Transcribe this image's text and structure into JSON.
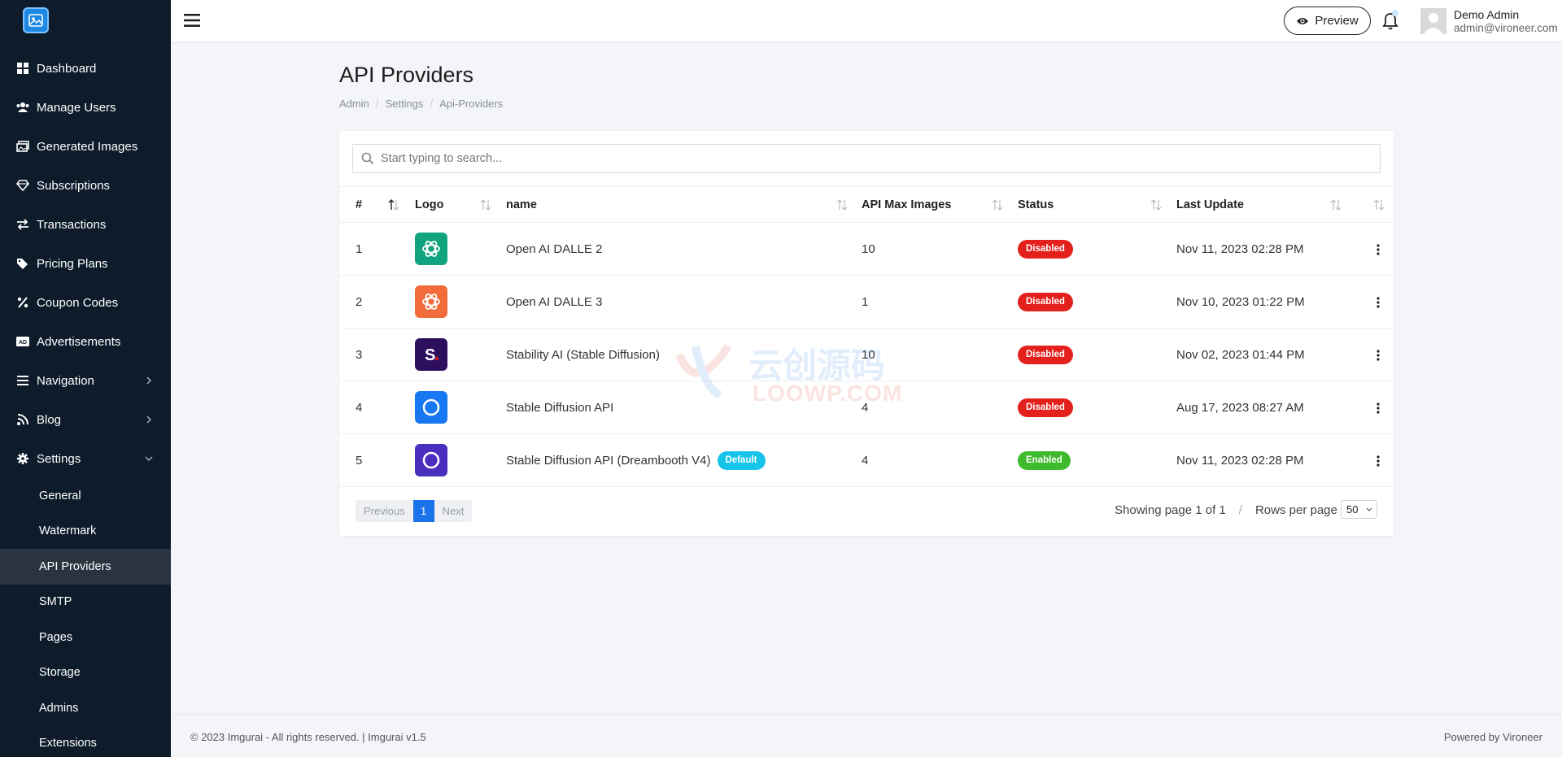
{
  "sidebar": {
    "items": [
      {
        "label": "Dashboard",
        "icon": "grid-icon"
      },
      {
        "label": "Manage Users",
        "icon": "users-icon"
      },
      {
        "label": "Generated Images",
        "icon": "images-icon"
      },
      {
        "label": "Subscriptions",
        "icon": "diamond-icon"
      },
      {
        "label": "Transactions",
        "icon": "exchange-icon"
      },
      {
        "label": "Pricing Plans",
        "icon": "tags-icon"
      },
      {
        "label": "Coupon Codes",
        "icon": "percent-icon"
      },
      {
        "label": "Advertisements",
        "icon": "ad-icon"
      },
      {
        "label": "Navigation",
        "icon": "bars-icon"
      },
      {
        "label": "Blog",
        "icon": "rss-icon"
      },
      {
        "label": "Settings",
        "icon": "gear-icon"
      }
    ],
    "settings_sub": [
      {
        "label": "General"
      },
      {
        "label": "Watermark"
      },
      {
        "label": "API Providers"
      },
      {
        "label": "SMTP"
      },
      {
        "label": "Pages"
      },
      {
        "label": "Storage"
      },
      {
        "label": "Admins"
      },
      {
        "label": "Extensions"
      }
    ]
  },
  "topbar": {
    "preview_label": "Preview",
    "user_name": "Demo Admin",
    "user_email": "admin@vironeer.com"
  },
  "page": {
    "title": "API Providers",
    "breadcrumb": [
      "Admin",
      "Settings",
      "Api-Providers"
    ]
  },
  "search": {
    "placeholder": "Start typing to search..."
  },
  "table": {
    "headers": [
      "#",
      "Logo",
      "name",
      "API Max Images",
      "Status",
      "Last Update"
    ],
    "rows": [
      {
        "num": "1",
        "name": "Open AI DALLE 2",
        "max": "10",
        "status": "Disabled",
        "updated": "Nov 11, 2023 02:28 PM",
        "logo_color": "#10a37f",
        "logo": "openai-logo-icon"
      },
      {
        "num": "2",
        "name": "Open AI DALLE 3",
        "max": "1",
        "status": "Disabled",
        "updated": "Nov 10, 2023 01:22 PM",
        "logo_color": "#f26b3a",
        "logo": "openai-logo-icon"
      },
      {
        "num": "3",
        "name": "Stability AI (Stable Diffusion)",
        "max": "10",
        "status": "Disabled",
        "updated": "Nov 02, 2023 01:44 PM",
        "logo_color": "#2d0f5e",
        "logo": "stability-logo-icon"
      },
      {
        "num": "4",
        "name": "Stable Diffusion API",
        "max": "4",
        "status": "Disabled",
        "updated": "Aug 17, 2023 08:27 AM",
        "logo_color": "#1877f2",
        "logo": "ring-logo-icon"
      },
      {
        "num": "5",
        "name": "Stable Diffusion API (Dreambooth V4)",
        "max": "4",
        "status": "Enabled",
        "updated": "Nov 11, 2023 02:28 PM",
        "logo_color": "#4a2fbf",
        "logo": "ring-logo-icon",
        "default_label": "Default"
      }
    ]
  },
  "pagination": {
    "prev": "Previous",
    "current": "1",
    "next": "Next",
    "showing": "Showing page 1 of 1",
    "sep": "/",
    "rows_label": "Rows per page",
    "rows_value": "50"
  },
  "watermark": {
    "line1": "云创源码",
    "line2": "LOOWP.COM"
  },
  "footer": {
    "left": "© 2023 Imgurai - All rights reserved. | Imgurai v1.5",
    "right": "Powered by Vironeer"
  },
  "colors": {
    "sidebar_bg": "#0d1b2a",
    "accent": "#1a73e8",
    "disabled": "#e3201c",
    "enabled": "#3dbb2d",
    "default": "#16c4ea"
  }
}
